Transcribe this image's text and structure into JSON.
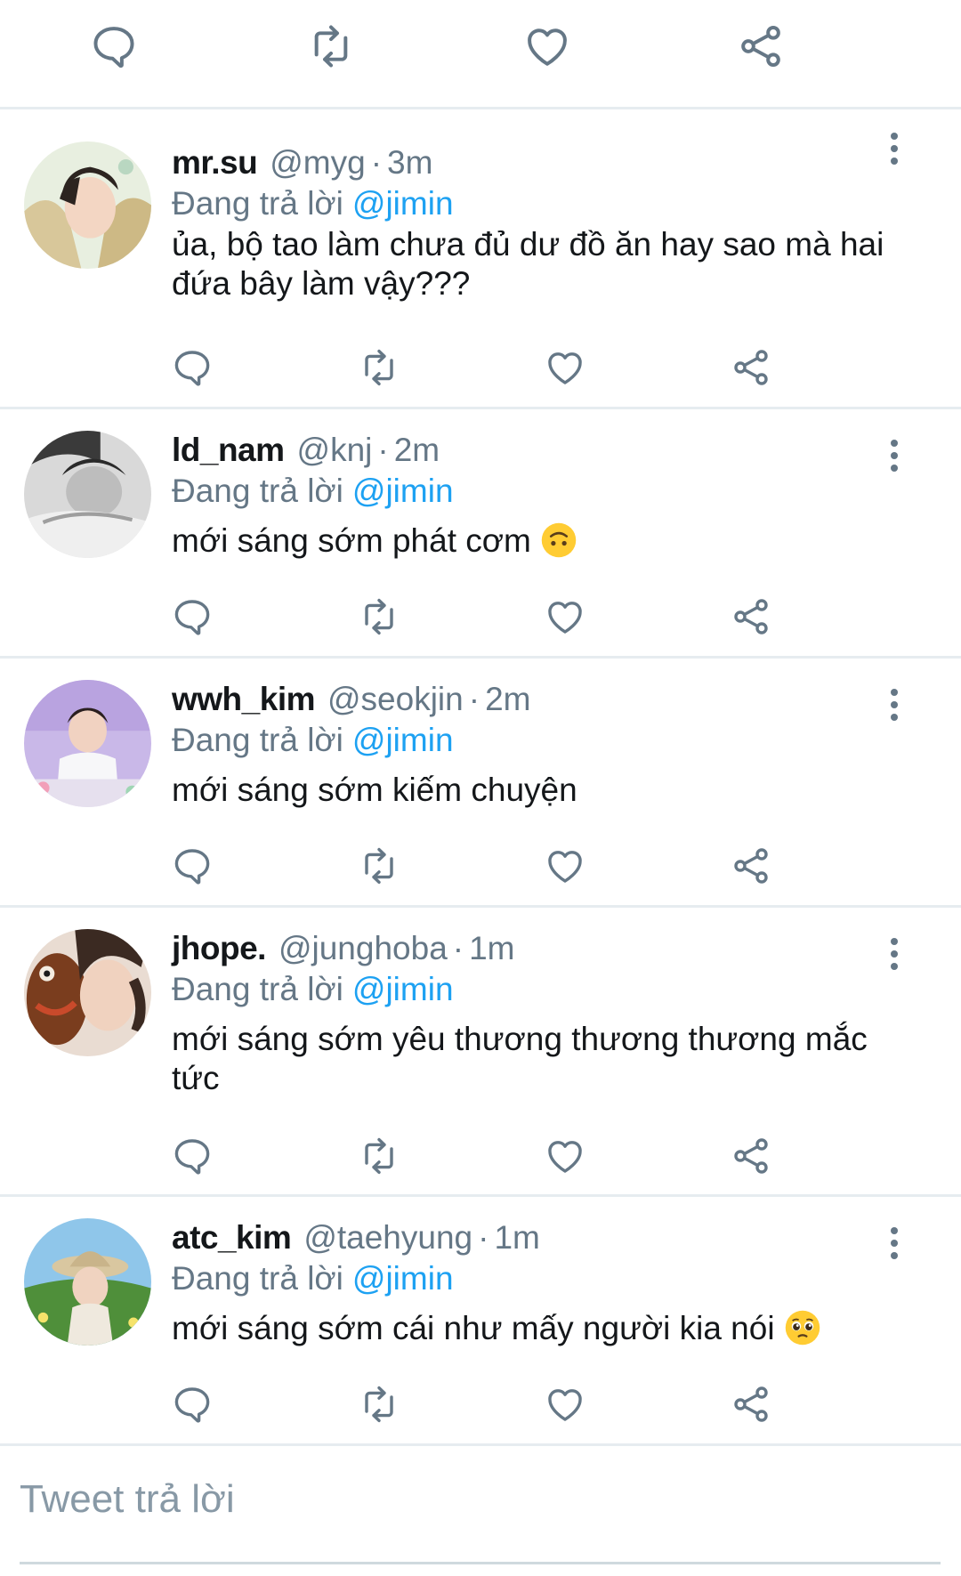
{
  "top_actions": {
    "icons": [
      "reply-icon",
      "retweet-icon",
      "like-icon",
      "share-icon"
    ]
  },
  "replies": [
    {
      "name": "mr.su",
      "handle": "@myg",
      "sep": "·",
      "time": "3m",
      "replying_label": "Đang trả lời",
      "mention": "@jimin",
      "text": "ủa, bộ tao làm chưa đủ dư đồ ăn hay sao mà hai đứa bây làm vậy???",
      "emoji": ""
    },
    {
      "name": "ld_nam",
      "handle": "@knj",
      "sep": "·",
      "time": "2m",
      "replying_label": "Đang trả lời",
      "mention": "@jimin",
      "text": "mới sáng sớm phát cơm",
      "emoji": "upside-down-face-emoji"
    },
    {
      "name": "wwh_kim",
      "handle": "@seokjin",
      "sep": "·",
      "time": "2m",
      "replying_label": "Đang trả lời",
      "mention": "@jimin",
      "text": "mới sáng sớm kiếm chuyện",
      "emoji": ""
    },
    {
      "name": "jhope.",
      "handle": "@junghoba",
      "sep": "·",
      "time": "1m",
      "replying_label": "Đang trả lời",
      "mention": "@jimin",
      "text": "mới sáng sớm yêu thương thương thương mắc tức",
      "emoji": ""
    },
    {
      "name": "atc_kim",
      "handle": "@taehyung",
      "sep": "·",
      "time": "1m",
      "replying_label": "Đang trả lời",
      "mention": "@jimin",
      "text": "mới sáng sớm cái như mấy người kia nói",
      "emoji": "pleading-face-emoji"
    }
  ],
  "compose": {
    "placeholder": "Tweet trả lời"
  },
  "colors": {
    "accent": "#1da1f2",
    "icon": "#657786",
    "divider": "#e6ecf0",
    "text": "#14171a"
  }
}
